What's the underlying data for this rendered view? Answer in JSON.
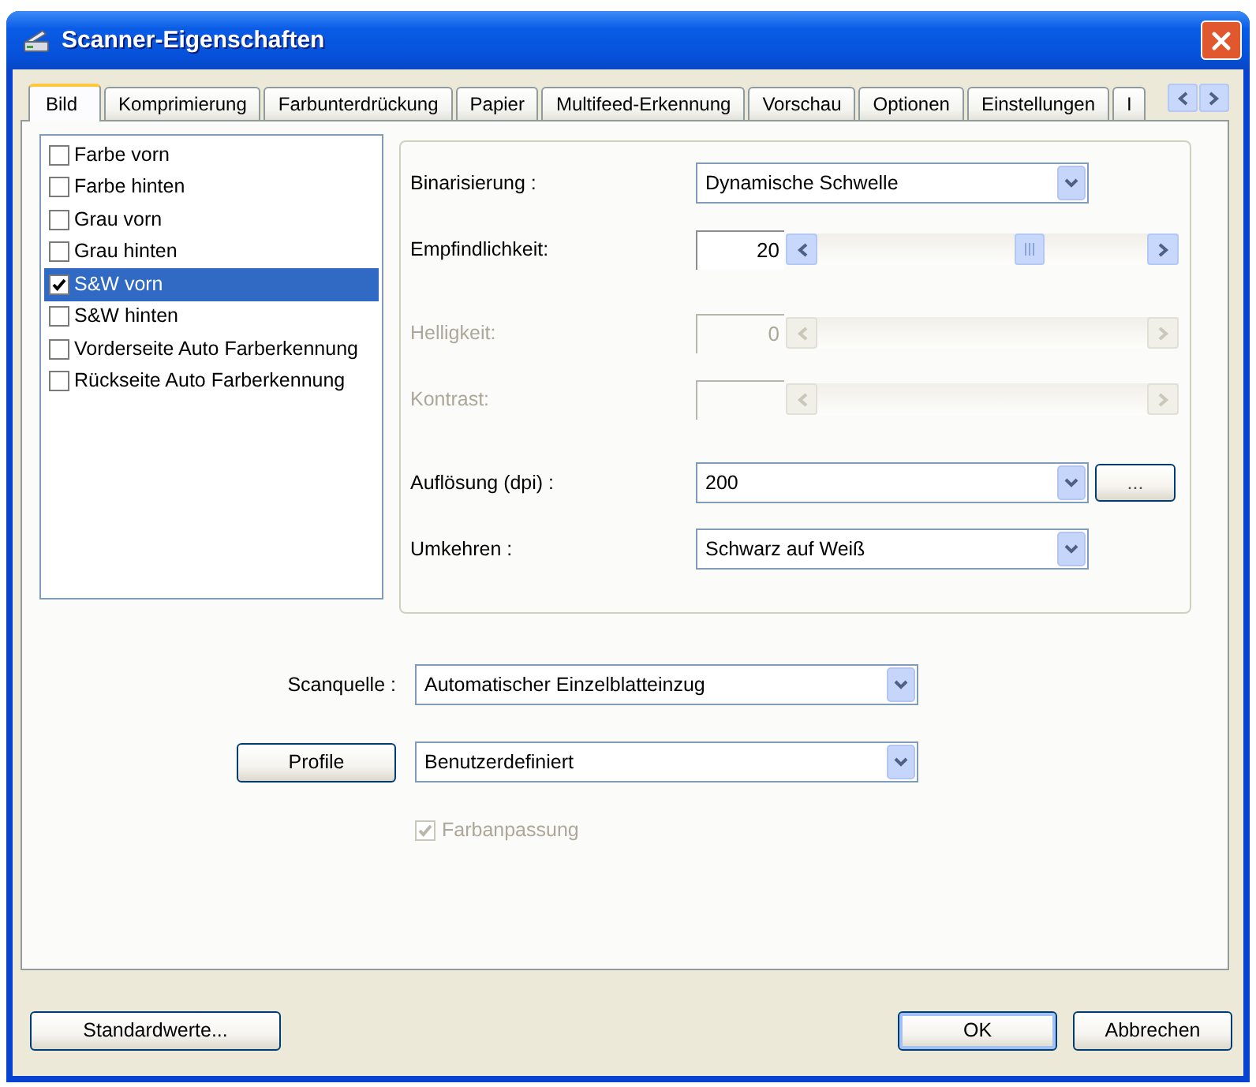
{
  "window": {
    "title": "Scanner-Eigenschaften"
  },
  "tabs": [
    {
      "label": "Bild",
      "selected": true
    },
    {
      "label": "Komprimierung",
      "selected": false
    },
    {
      "label": "Farbunterdrückung",
      "selected": false
    },
    {
      "label": "Papier",
      "selected": false
    },
    {
      "label": "Multifeed-Erkennung",
      "selected": false
    },
    {
      "label": "Vorschau",
      "selected": false
    },
    {
      "label": "Optionen",
      "selected": false
    },
    {
      "label": "Einstellungen",
      "selected": false
    },
    {
      "label": "I",
      "selected": false
    }
  ],
  "image_list": [
    {
      "label": "Farbe vorn",
      "checked": false,
      "selected": false
    },
    {
      "label": "Farbe hinten",
      "checked": false,
      "selected": false
    },
    {
      "label": "Grau vorn",
      "checked": false,
      "selected": false
    },
    {
      "label": "Grau hinten",
      "checked": false,
      "selected": false
    },
    {
      "label": "S&W vorn",
      "checked": true,
      "selected": true
    },
    {
      "label": "S&W hinten",
      "checked": false,
      "selected": false
    },
    {
      "label": "Vorderseite Auto Farberkennung",
      "checked": false,
      "selected": false
    },
    {
      "label": "Rückseite Auto Farberkennung",
      "checked": false,
      "selected": false
    }
  ],
  "settings_groups": [
    {
      "rows": [
        {
          "kind": "dropdown",
          "label": "Binarisierung :",
          "value": "Dynamische Schwelle",
          "disabled": false
        },
        {
          "kind": "slider",
          "label": "Empfindlichkeit:",
          "value": "20",
          "level": 0.66,
          "disabled": false
        }
      ]
    },
    {
      "rows": [
        {
          "kind": "slider",
          "label": "Helligkeit:",
          "value": "0",
          "disabled": true
        },
        {
          "kind": "slider",
          "label": "Kontrast:",
          "disabled": true
        }
      ]
    },
    {
      "rows": [
        {
          "kind": "dropdown",
          "label": "Auflösung (dpi) :",
          "value": "200",
          "button": "...",
          "disabled": false
        },
        {
          "kind": "dropdown",
          "label": "Umkehren :",
          "value": "Schwarz auf Weiß",
          "disabled": false
        }
      ]
    }
  ],
  "scan_source": {
    "label": "Scanquelle :",
    "value": "Automatischer Einzelblatteinzug"
  },
  "profile": {
    "button": "Profile",
    "value": "Benutzerdefiniert"
  },
  "color_matching": {
    "label": "Farbanpassung",
    "checked": true,
    "disabled": true
  },
  "footer": {
    "left_buttons": [
      {
        "label": "Standardwerte...",
        "default": false
      }
    ],
    "right_buttons": [
      {
        "label": "OK",
        "default": true
      },
      {
        "label": "Abbrechen",
        "default": false
      }
    ]
  }
}
